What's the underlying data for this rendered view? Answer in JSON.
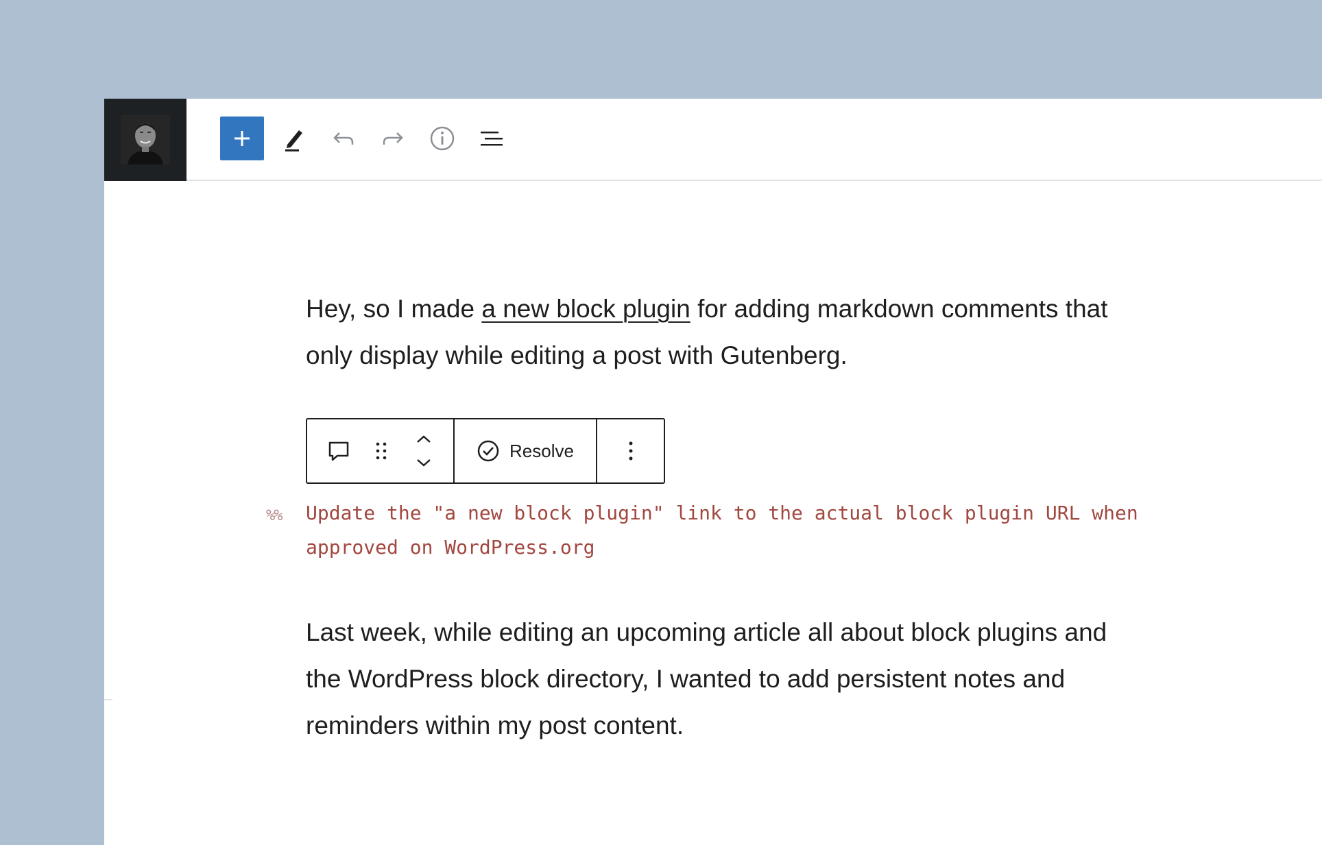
{
  "toolbar": {
    "add_icon": "plus-icon",
    "edit_icon": "pencil-icon",
    "undo_icon": "undo-icon",
    "redo_icon": "redo-icon",
    "info_icon": "info-icon",
    "outline_icon": "list-view-icon",
    "add_color": "#3376c0"
  },
  "content": {
    "paragraph1": {
      "before_link": "Hey, so I made ",
      "link_text": "a new block plugin",
      "after_link": " for adding markdown comments that only display while editing a post with Gutenberg."
    },
    "block_toolbar": {
      "comment_icon": "comment-icon",
      "drag_icon": "drag-handle-icon",
      "move_up_icon": "chevron-up-icon",
      "move_down_icon": "chevron-down-icon",
      "resolve_icon": "check-circle-icon",
      "resolve_label": "Resolve",
      "more_icon": "more-vertical-icon"
    },
    "note": {
      "prefix": "%%",
      "text": "Update the \"a new block plugin\" link to the actual block plugin URL when approved on WordPress.org",
      "color": "#a1473f"
    },
    "paragraph2": "Last week, while editing an upcoming article all about block plugins and the WordPress block directory, I wanted to add persistent notes and reminders within my post content."
  }
}
